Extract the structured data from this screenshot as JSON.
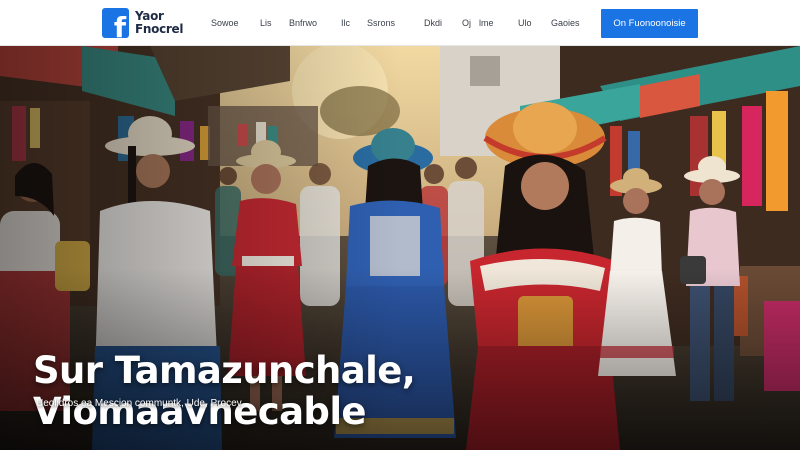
{
  "header": {
    "brand_line1": "Yaor",
    "brand_line2": "Fnocrel",
    "nav": [
      "Sowoe",
      "Lis",
      "Bnfrwo",
      "Ilc",
      "Ssrons",
      "Dkdi",
      "Oj",
      "lme",
      "Ulo",
      "Gaoies"
    ],
    "cta_label": "On Fuonoonoisie",
    "brand_color": "#1b74e4"
  },
  "hero": {
    "headline_line1": "Sur Tamazunchale,",
    "headline_line2": "Viomaavnecable",
    "subline": "Ueolidros ea Mescion communtk, Ude, Procev."
  }
}
